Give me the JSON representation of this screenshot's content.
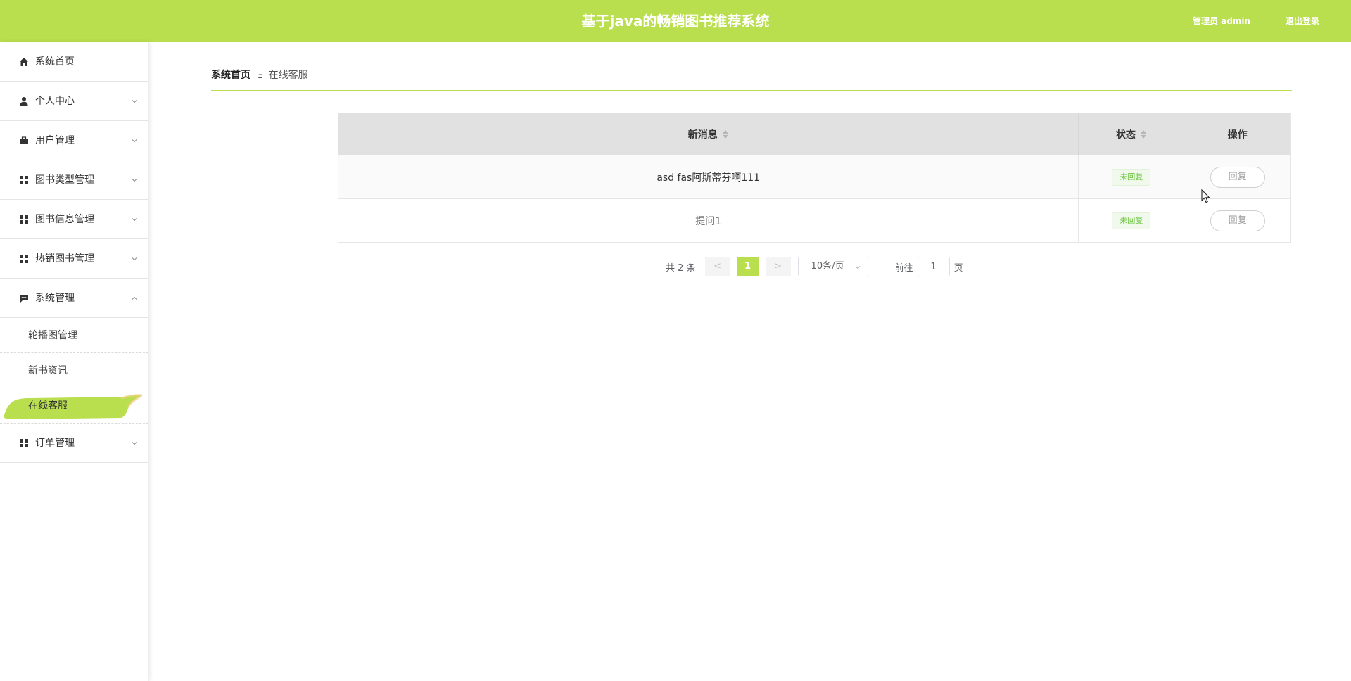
{
  "header": {
    "title": "基于java的畅销图书推荐系统",
    "user": "管理员 admin",
    "logout": "退出登录"
  },
  "sidebar": {
    "items": [
      {
        "label": "系统首页",
        "icon": "home-icon"
      },
      {
        "label": "个人中心",
        "icon": "user-icon"
      },
      {
        "label": "用户管理",
        "icon": "briefcase-icon"
      },
      {
        "label": "图书类型管理",
        "icon": "grid-icon"
      },
      {
        "label": "图书信息管理",
        "icon": "grid-icon"
      },
      {
        "label": "热销图书管理",
        "icon": "grid-icon"
      },
      {
        "label": "系统管理",
        "icon": "chat-icon"
      }
    ],
    "subitems": [
      {
        "label": "轮播图管理"
      },
      {
        "label": "新书资讯"
      },
      {
        "label": "在线客服",
        "active": true
      }
    ],
    "last": {
      "label": "订单管理",
      "icon": "grid-icon"
    }
  },
  "breadcrumb": {
    "home": "系统首页",
    "separator": "Ξ",
    "current": "在线客服"
  },
  "table": {
    "columns": [
      "新消息",
      "状态",
      "操作"
    ],
    "rows": [
      {
        "message": "asd fas阿斯蒂芬啊111",
        "status": "未回复",
        "action": "回复"
      },
      {
        "message": "提问1",
        "status": "未回复",
        "action": "回复"
      }
    ]
  },
  "pagination": {
    "total": "共 2 条",
    "prev": "<",
    "page": "1",
    "next": ">",
    "page_size": "10条/页",
    "goto_prefix": "前往",
    "goto_value": "1",
    "goto_suffix": "页"
  },
  "colors": {
    "accent": "#b9de4e",
    "status_green": "#67c23a"
  }
}
